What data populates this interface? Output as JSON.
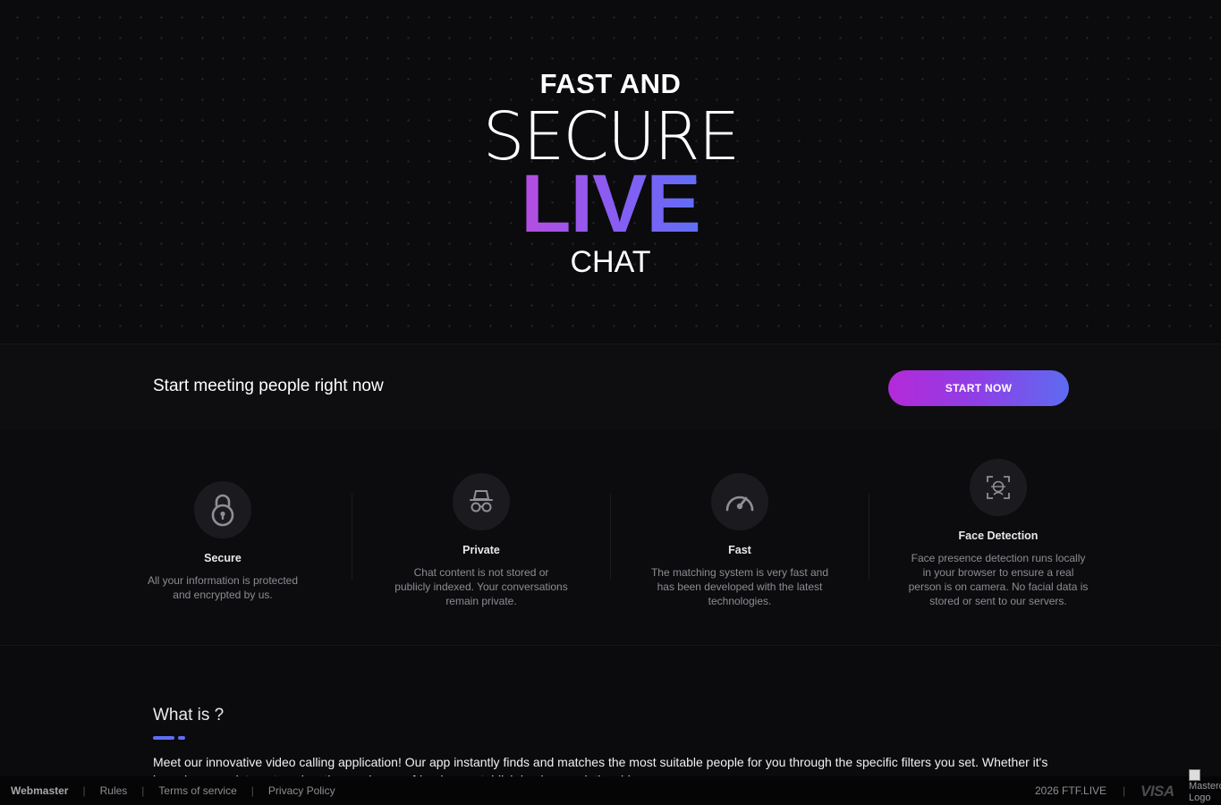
{
  "hero": {
    "line1": "FAST AND",
    "line2": "SECURE",
    "line3": "LIVE",
    "line4": "CHAT"
  },
  "cta": {
    "text": "Start meeting people right now",
    "button_label": "START NOW"
  },
  "features": [
    {
      "icon": "lock-icon",
      "title": "Secure",
      "description": "All your information is protected and encrypted by us."
    },
    {
      "icon": "incognito-icon",
      "title": "Private",
      "description": "Chat content is not stored or publicly indexed. Your conversations remain private."
    },
    {
      "icon": "speedometer-icon",
      "title": "Fast",
      "description": "The matching system is very fast and has been developed with the latest technologies."
    },
    {
      "icon": "face-scan-icon",
      "title": "Face Detection",
      "description": "Face presence detection runs locally in your browser to ensure a real person is on camera. No facial data is stored or sent to our servers."
    }
  ],
  "about": {
    "title": "What is ?",
    "paragraph": "Meet our innovative video calling application! Our app instantly finds and matches the most suitable people for you through the specific filters you set. Whether it's based on your interests or location, make new friends or establish business relationships."
  },
  "footer": {
    "links": [
      "Webmaster",
      "Rules",
      "Terms of service",
      "Privacy Policy"
    ],
    "copyright": "2026 FTF.LIVE",
    "payment_visa": "VISA",
    "payment_mastercard_alt": "Mastercard Logo"
  },
  "colors": {
    "accent_start": "#b42ad8",
    "accent_end": "#5d6cf1",
    "background": "#0b0b0e"
  }
}
